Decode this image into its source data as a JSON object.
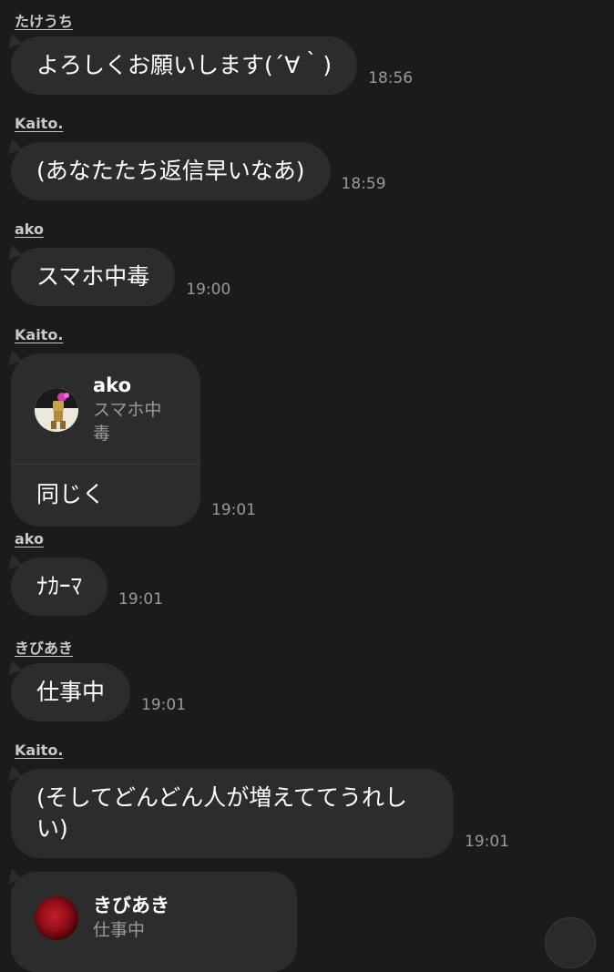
{
  "messages": [
    {
      "sender": "たけうち",
      "text": "よろしくお願いします(´∀｀)",
      "time": "18:56"
    },
    {
      "sender": "Kaito.",
      "text": "(あなたたち返信早いなあ)",
      "time": "18:59"
    },
    {
      "sender": "ako",
      "text": "スマホ中毒",
      "time": "19:00"
    },
    {
      "sender": "Kaito.",
      "reply_to": {
        "name": "ako",
        "text": "スマホ中毒"
      },
      "text": "同じく",
      "time": "19:01"
    },
    {
      "sender": "ako",
      "text": "ﾅｶｰﾏ",
      "time": "19:01"
    },
    {
      "sender": "きびあき",
      "text": "仕事中",
      "time": "19:01"
    },
    {
      "sender": "Kaito.",
      "text": "(そしてどんどん人が増えててうれしい)",
      "time": "19:01"
    },
    {
      "reply_to": {
        "name": "きびあき",
        "text": "仕事中"
      }
    }
  ],
  "colors": {
    "background": "#1b1b1b",
    "bubble": "#2c2c2c",
    "sender_text": "#c9c9c9",
    "time_text": "#9a9a9a"
  },
  "icons": {
    "ako_avatar": "cartoon-character-avatar-icon",
    "kibiaki_avatar": "red-flower-avatar-icon",
    "scroll_button": "scroll-down-button"
  }
}
